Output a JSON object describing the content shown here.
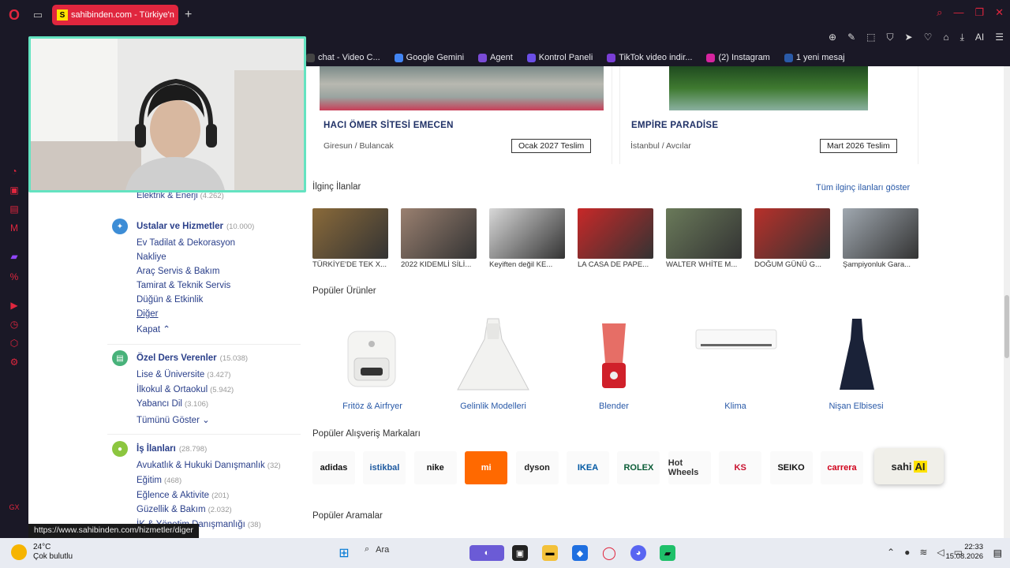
{
  "browser": {
    "tab_title": "sahibinden.com - Türkiye'n",
    "tab_favicon": "S",
    "bookmarks": [
      {
        "label": "chat - Video C...",
        "color": "#444"
      },
      {
        "label": "Google Gemini",
        "color": "#4285f4"
      },
      {
        "label": "Agent",
        "color": "#7a4bd6"
      },
      {
        "label": "Kontrol Paneli",
        "color": "#6b4ee6"
      },
      {
        "label": "TikTok video indir...",
        "color": "#7a3ed6"
      },
      {
        "label": "(2) Instagram",
        "color": "#d6249f"
      },
      {
        "label": "1 yeni mesaj",
        "color": "#2a5aa8"
      }
    ],
    "tools_ai": "AI"
  },
  "sidebar": {
    "partial_item": "Elektrik & Enerji",
    "partial_count": "(4.262)",
    "categories": [
      {
        "title": "Ustalar ve Hizmetler",
        "count": "(10.000)",
        "color": "#3d8dd6",
        "items": [
          {
            "label": "Ev Tadilat & Dekorasyon",
            "count": ""
          },
          {
            "label": "Nakliye",
            "count": ""
          },
          {
            "label": "Araç Servis & Bakım",
            "count": ""
          },
          {
            "label": "Tamirat & Teknik Servis",
            "count": ""
          },
          {
            "label": "Düğün & Etkinlik",
            "count": ""
          },
          {
            "label": "Diğer",
            "count": ""
          }
        ],
        "toggle": "Kapat"
      },
      {
        "title": "Özel Ders Verenler",
        "count": "(15.038)",
        "color": "#48b27a",
        "items": [
          {
            "label": "Lise & Üniversite",
            "count": "(3.427)"
          },
          {
            "label": "İlkokul & Ortaokul",
            "count": "(5.942)"
          },
          {
            "label": "Yabancı Dil",
            "count": "(3.106)"
          }
        ],
        "toggle": "Tümünü Göster"
      },
      {
        "title": "İş İlanları",
        "count": "(28.798)",
        "color": "#8cc63f",
        "items": [
          {
            "label": "Avukatlık & Hukuki Danışmanlık",
            "count": "(32)"
          },
          {
            "label": "Eğitim",
            "count": "(468)"
          },
          {
            "label": "Eğlence & Aktivite",
            "count": "(201)"
          },
          {
            "label": "Güzellik & Bakım",
            "count": "(2.032)"
          },
          {
            "label": "İK & Yönetim Danışmanlığı",
            "count": "(38)"
          }
        ]
      }
    ],
    "status_url": "https://www.sahibinden.com/hizmetler/diger"
  },
  "projects": [
    {
      "title": "HACI ÖMER SİTESİ EMECEN",
      "location": "Giresun / Bulancak",
      "badge": "Ocak 2027 Teslim"
    },
    {
      "title": "EMPİRE PARADİSE",
      "location": "İstanbul / Avcılar",
      "badge": "Mart 2026 Teslim"
    }
  ],
  "interesting": {
    "heading": "İlginç İlanlar",
    "link": "Tüm ilginç ilanları göster",
    "items": [
      {
        "caption": "TÜRKİYE'DE TEK X...",
        "color": "#8a6a3a"
      },
      {
        "caption": "2022 KIDEMLİ SİLİ...",
        "color": "#9a8070"
      },
      {
        "caption": "Keyiften değil KE...",
        "color": "#d8d8d8"
      },
      {
        "caption": "LA CASA DE PAPE...",
        "color": "#c82828"
      },
      {
        "caption": "WALTER WHİTE M...",
        "color": "#6a7a5a"
      },
      {
        "caption": "DOĞUM GÜNÜ G...",
        "color": "#b8302a"
      },
      {
        "caption": "Şampiyonluk Gara...",
        "color": "#a0a8b0"
      }
    ]
  },
  "popular_products": {
    "heading": "Popüler Ürünler",
    "items": [
      {
        "caption": "Fritöz & Airfryer"
      },
      {
        "caption": "Gelinlik Modelleri"
      },
      {
        "caption": "Blender"
      },
      {
        "caption": "Klima"
      },
      {
        "caption": "Nişan Elbisesi"
      }
    ]
  },
  "brands": {
    "heading": "Popüler Alışveriş Markaları",
    "items": [
      {
        "label": "adidas",
        "color": "#111"
      },
      {
        "label": "istikbal",
        "color": "#1e5aa0"
      },
      {
        "label": "nike",
        "color": "#111"
      },
      {
        "label": "mi",
        "color": "#ff6900"
      },
      {
        "label": "dyson",
        "color": "#222"
      },
      {
        "label": "IKEA",
        "color": "#0058a3"
      },
      {
        "label": "ROLEX",
        "color": "#0a5c36"
      },
      {
        "label": "Hot Wheels",
        "color": "#333"
      },
      {
        "label": "KS",
        "color": "#c8102e"
      },
      {
        "label": "SEIKO",
        "color": "#111"
      },
      {
        "label": "carrera",
        "color": "#d0021b"
      }
    ],
    "ai_label": "sahi",
    "ai_badge": "AI"
  },
  "popular_searches": {
    "heading": "Popüler Aramalar"
  },
  "taskbar": {
    "temperature": "24°C",
    "weather": "Çok bulutlu",
    "search_placeholder": "Ara",
    "time": "22:33",
    "date": "15.08.2026"
  }
}
